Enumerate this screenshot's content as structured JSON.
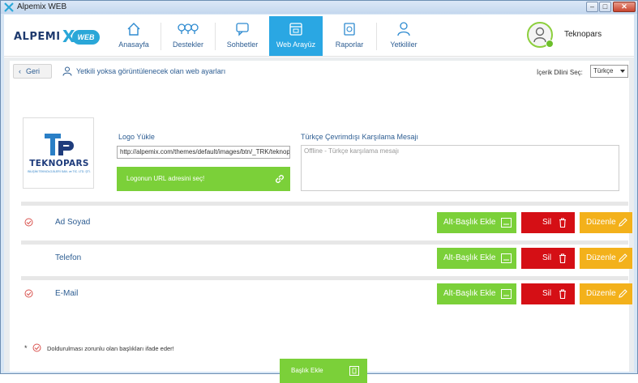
{
  "window": {
    "title": "Alpemix WEB",
    "min_label": "–",
    "max_label": "□",
    "close_label": "✕"
  },
  "brand": {
    "word": "ALPEMI",
    "x": "X",
    "web": "WEB"
  },
  "nav": [
    {
      "label": "Anasayfa",
      "icon": "home-icon"
    },
    {
      "label": "Destekler",
      "icon": "location-pins-icon"
    },
    {
      "label": "Sohbetler",
      "icon": "chat-icon"
    },
    {
      "label": "Web Arayüz",
      "icon": "browser-icon",
      "active": true
    },
    {
      "label": "Raporlar",
      "icon": "report-icon"
    },
    {
      "label": "Yetkililer",
      "icon": "user-icon"
    }
  ],
  "user": {
    "name": "Teknopars",
    "status_color": "#6cbf2a"
  },
  "toolbar": {
    "back_label": "Geri",
    "info_text": "Yetkili yoksa görüntülenecek olan web ayarları",
    "language_label": "İçerik Dilini Seç:",
    "language_value": "Türkçe"
  },
  "company_logo": {
    "name": "TEKNOPARS",
    "subtitle": "BİLİŞİM TEKNOLOJİLERİ SAN. ve TİC. LTD. ŞTİ."
  },
  "logo_upload": {
    "title": "Logo Yükle",
    "url_value": "http://alpemix.com/themes/default/images/btn/_TRK/teknop",
    "select_button": "Logonun URL adresini seç!"
  },
  "welcome": {
    "title": "Türkçe Çevrimdışı Karşılama Mesajı",
    "placeholder": "Offline - Türkçe karşılama mesajı"
  },
  "fields": [
    {
      "label": "Ad  Soyad",
      "required": true
    },
    {
      "label": "Telefon",
      "required": false
    },
    {
      "label": "E-Mail",
      "required": true
    }
  ],
  "field_buttons": {
    "subheader": "Alt-Başlık Ekle",
    "delete": "Sil",
    "edit": "Düzenle"
  },
  "legend": {
    "star": "*",
    "text": "Doldurulması zorunlu olan başlıkları ifade eder!"
  },
  "add_header_button": "Başlık Ekle",
  "colors": {
    "accent": "#2aa7e3",
    "green": "#7bd039",
    "red": "#d50f15",
    "orange": "#f3b11b",
    "navy": "#2d5d92"
  }
}
